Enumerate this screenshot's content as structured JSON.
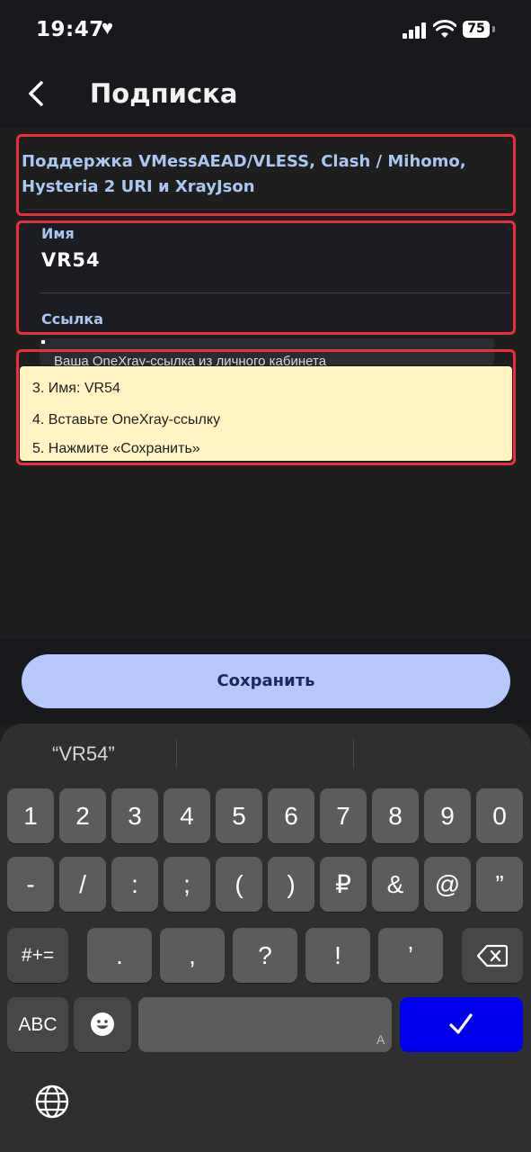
{
  "status_bar": {
    "time": "19:47",
    "battery": "75"
  },
  "nav": {
    "title": "Подписка"
  },
  "form": {
    "support_line1": "Поддержка VMessAEAD/VLESS, Clash / Mihomo,",
    "support_line2": "Hysteria 2 URI и XrayJson",
    "name_label": "Имя",
    "name_value": "VR54",
    "link_label": "Ссылка",
    "link_placeholder": "Ваша OneXray-ссылка из личного кабинета"
  },
  "tooltip": {
    "steps": [
      "3. Имя: VR54",
      "4. Вставьте OneXray-ссылку",
      "5. Нажмите «Сохранить»"
    ]
  },
  "save_button": {
    "label": "Сохранить"
  },
  "keyboard": {
    "suggestion": "“VR54”",
    "row1": [
      "1",
      "2",
      "3",
      "4",
      "5",
      "6",
      "7",
      "8",
      "9",
      "0"
    ],
    "row2": [
      "-",
      "/",
      ":",
      ";",
      "(",
      ")",
      "₽",
      "&",
      "@",
      "”"
    ],
    "row3": [
      "#+=",
      ".",
      ",",
      "?",
      "!",
      "’"
    ],
    "abc_label": "ABC",
    "space_hint": "A"
  },
  "colors": {
    "accent_label": "#a9c7f2",
    "save_button_bg": "#b7c8ff",
    "enter_key_bg": "#0000ee",
    "tooltip_bg": "#fff4c2",
    "highlight_border": "#e8303a"
  }
}
